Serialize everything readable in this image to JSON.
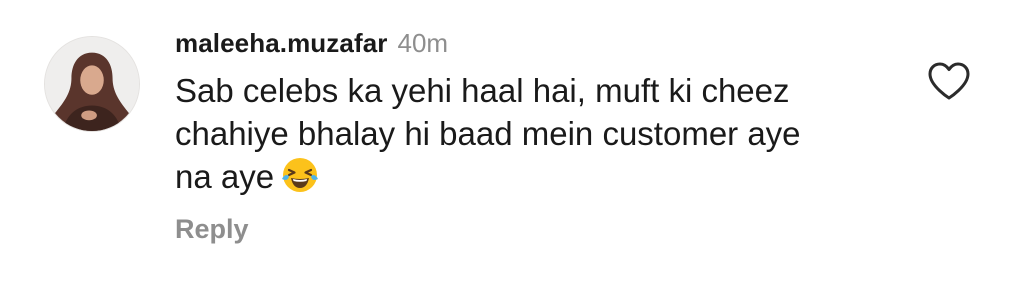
{
  "comment": {
    "username": "maleeha.muzafar",
    "timestamp": "40m",
    "text": "Sab celebs ka yehi haal hai, muft ki cheez chahiye bhalay hi baad mein customer aye na aye",
    "emoji": "face-with-tears-of-joy",
    "reply_label": "Reply",
    "like_icon": "heart-outline-icon"
  },
  "colors": {
    "text": "#1a1a1a",
    "secondary": "#8e8e8e",
    "emoji_yellow": "#fcc21b"
  }
}
